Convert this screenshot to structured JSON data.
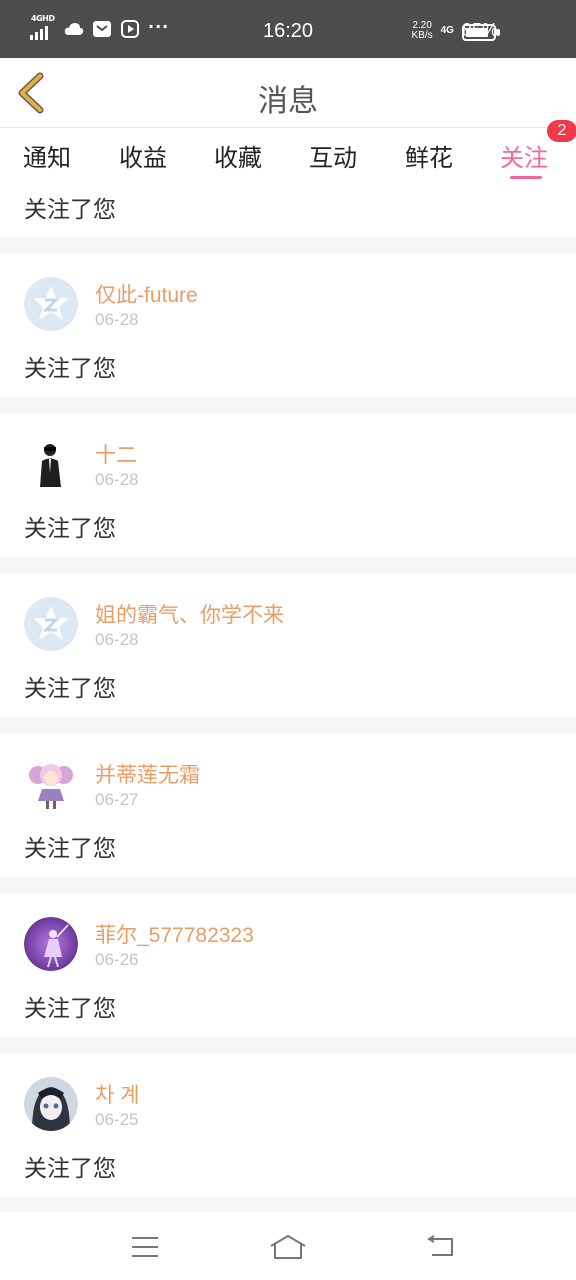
{
  "status_bar": {
    "network": "4GHD",
    "time": "16:20",
    "speed_value": "2.20",
    "speed_unit": "KB/s",
    "mobile": "4G",
    "battery_pct": "85%",
    "battery_level": 0.85
  },
  "header": {
    "title": "消息"
  },
  "tabs": [
    {
      "label": "通知"
    },
    {
      "label": "收益"
    },
    {
      "label": "收藏"
    },
    {
      "label": "互动"
    },
    {
      "label": "鲜花"
    },
    {
      "label": "关注",
      "active": true,
      "badge": "2"
    }
  ],
  "partial_item": {
    "message": "关注了您"
  },
  "items": [
    {
      "name": "仅此-future",
      "date": "06-28",
      "message": "关注了您",
      "avatar": "default-star-avatar"
    },
    {
      "name": "十二",
      "date": "06-28",
      "message": "关注了您",
      "avatar": "person-in-suit-avatar"
    },
    {
      "name": "姐的霸气、你学不来",
      "date": "06-28",
      "message": "关注了您",
      "avatar": "default-star-avatar"
    },
    {
      "name": "并蒂莲无霜",
      "date": "06-27",
      "message": "关注了您",
      "avatar": "anime-girl-pink-avatar"
    },
    {
      "name": "菲尔_577782323",
      "date": "06-26",
      "message": "关注了您",
      "avatar": "purple-dancer-avatar"
    },
    {
      "name": "차 계",
      "date": "06-25",
      "message": "关注了您",
      "avatar": "anime-girl-dark-avatar"
    }
  ],
  "colors": {
    "accent": "#ee6a9a",
    "username": "#e89e66",
    "badge": "#f2394a",
    "back_arrow": "#d9a23a"
  }
}
